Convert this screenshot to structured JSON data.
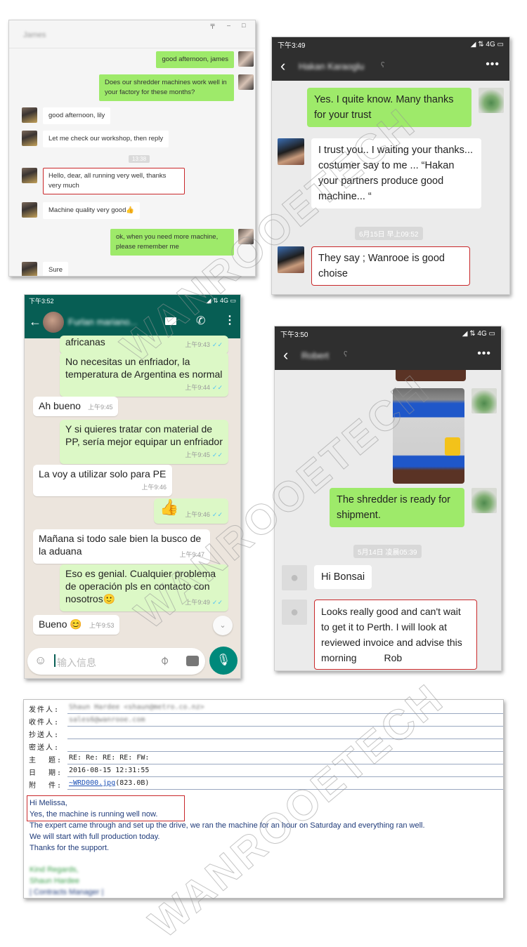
{
  "watermark": "WANROOETECH",
  "desktop_chat": {
    "contact_name": "James",
    "window_controls": [
      "pin",
      "minimize",
      "maximize"
    ],
    "messages": [
      {
        "side": "out",
        "text": "good afternoon,  james"
      },
      {
        "side": "out",
        "text": "Does our shredder machines work well in your factory for these months?"
      },
      {
        "side": "in",
        "text": "good afternoon, lily"
      },
      {
        "side": "in",
        "text": "Let me check our workshop, then reply"
      },
      {
        "side": "in",
        "text": "Hello, dear, all running very well, thanks very much",
        "highlighted": true
      },
      {
        "side": "in",
        "text": "Machine quality very good👍"
      },
      {
        "side": "out",
        "text": "ok, when you need more  machine, please remember me"
      },
      {
        "side": "in",
        "text": "Sure"
      }
    ],
    "timestamp": "13:38"
  },
  "hakan_chat": {
    "status_time": "下午3:49",
    "status_icons": "◢ ⇅ 4G ▭",
    "contact_name": "Hakan Karaoglu",
    "messages": [
      {
        "side": "out",
        "text": "Yes. I quite know. Many thanks for your trust"
      },
      {
        "side": "in",
        "text": "I trust you.. I waiting your thanks... costumer say to me ... “Hakan your partners produce good machine... “"
      },
      {
        "side": "in",
        "text": "They say ; Wanrooe is good choise",
        "highlighted": true
      }
    ],
    "timestamp": "6月15日 早上09:52"
  },
  "whatsapp_chat": {
    "status_time": "下午3:52",
    "status_icons": "◢ ⇅ 4G ▭",
    "contact_name": "Furlan mariano...",
    "messages": [
      {
        "side": "out",
        "text": "africanas",
        "time": "上午9:43",
        "read": true
      },
      {
        "side": "out",
        "text": "No necesitas un enfriador, la temperatura de Argentina es normal",
        "time": "上午9:44",
        "read": true
      },
      {
        "side": "in",
        "text": "Ah bueno",
        "time": "上午9:45"
      },
      {
        "side": "out",
        "text": "Y si quieres tratar con material de PP, sería mejor equipar un enfriador",
        "time": "上午9:45",
        "read": true
      },
      {
        "side": "in",
        "text": "La voy a utilizar solo para PE",
        "time": "上午9:46"
      },
      {
        "side": "out",
        "text": "👍",
        "time": "上午9:46",
        "read": true
      },
      {
        "side": "in",
        "text": "Mañana si todo sale bien la busco de la aduana",
        "time": "上午9:47"
      },
      {
        "side": "out",
        "text": "Eso es genial. Cualquier problema de operación pls en contacto con nosotros🙂",
        "time": "上午9:49",
        "read": true
      },
      {
        "side": "in",
        "text": "Bueno 😊",
        "time": "上午9:53"
      }
    ],
    "input_placeholder": "输入信息"
  },
  "robert_chat": {
    "status_time": "下午3:50",
    "status_icons": "◢ ⇅ 4G ▭",
    "contact_name": "Robert",
    "messages": [
      {
        "side": "out",
        "type": "image",
        "text": "shredder machine photo"
      },
      {
        "side": "out",
        "text": "The shredder is ready for shipment."
      },
      {
        "side": "in",
        "text": "Hi Bonsai"
      },
      {
        "side": "in",
        "text": "Looks really good and can't wait to get it to Perth. I will look at reviewed invoice and advise this morning          Rob",
        "highlighted": true
      }
    ],
    "timestamp": "5月14日 凌晨05:39"
  },
  "email": {
    "headers": [
      {
        "label": "发件人:",
        "value": "Shaun Hardee <shaun@metro.co.nz>",
        "blurred": true
      },
      {
        "label": "收件人:",
        "value": "sales6@wanrooe.com",
        "blurred": true
      },
      {
        "label": "抄送人:",
        "value": ""
      },
      {
        "label": "密送人:",
        "value": ""
      },
      {
        "label": "主  题:",
        "value": "RE: Re: RE: RE: FW:"
      },
      {
        "label": "日  期:",
        "value": "2016-08-15 12:31:55"
      },
      {
        "label": "附  件:",
        "value": "~WRD000.jpg",
        "size": "(823.0B)"
      }
    ],
    "body": [
      "Hi Melissa,",
      "Yes, the machine is running well now.",
      "The expert came through and set up the drive, we ran the machine for an hour on Saturday and everything ran well.",
      "We will start with full production today.",
      "Thanks for the support."
    ],
    "signature": [
      "Kind Regards,",
      "Shaun Hardee",
      "| Contracts Manager |"
    ]
  },
  "colors": {
    "wechat_green": "#9eea6a",
    "whatsapp_teal": "#075e54",
    "whatsapp_bubble": "#dcf8c6",
    "highlight_red": "#c9282a",
    "email_text": "#1f3b7a"
  }
}
